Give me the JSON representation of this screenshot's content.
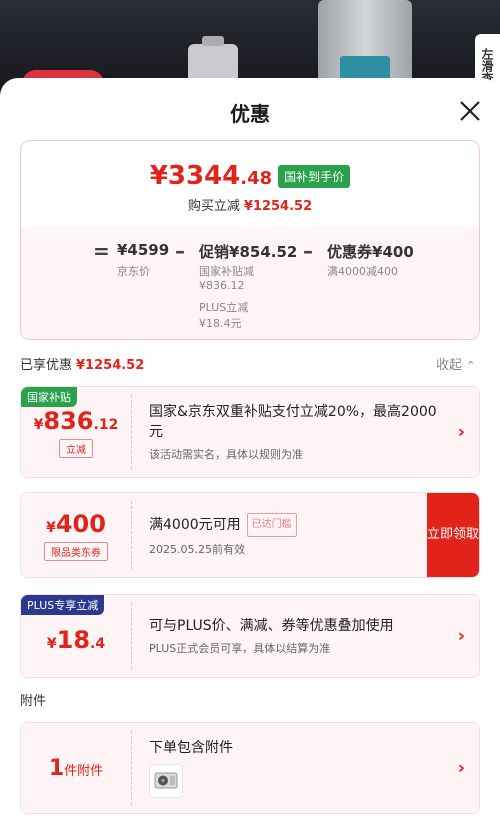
{
  "background": {
    "side_tab": "左滑查"
  },
  "sheet": {
    "title": "优惠"
  },
  "summary": {
    "final_price_int": "¥3344",
    "final_price_dec": ".48",
    "badge": "国补到手价",
    "saving_label": "购买立减",
    "saving_amount": "¥1254.52",
    "breakdown": {
      "jd_price": "¥4599",
      "jd_price_label": "京东价",
      "promo_label": "促销",
      "promo_amount": "¥854.52",
      "promo_sub1": "国家补贴减",
      "promo_sub1_amount": "¥836.12",
      "promo_sub2": "PLUS立减",
      "promo_sub2_amount": "¥18.4元",
      "coupon_label": "优惠券",
      "coupon_amount": "¥400",
      "coupon_sub": "满4000减400"
    }
  },
  "enjoyed": {
    "label": "已享优惠",
    "amount": "¥1254.52",
    "collapse": "收起"
  },
  "coupons": [
    {
      "corner": "国家补贴",
      "yen": "¥",
      "int": "836",
      "dec": ".12",
      "tag": "立减",
      "title": "国家&京东双重补贴支付立减20%，最高2000元",
      "desc": "该活动需实名，具体以规则为准"
    },
    {
      "yen": "¥",
      "int": "400",
      "tag": "限品类东券",
      "title": "满4000元可用",
      "title_tag": "已达门槛",
      "desc": "2025.05.25前有效",
      "button": "立即领取"
    },
    {
      "corner": "PLUS专享立减",
      "yen": "¥",
      "int": "18",
      "dec": ".4",
      "title": "可与PLUS价、满减、券等优惠叠加使用",
      "desc": "PLUS正式会员可享，具体以结算为准"
    }
  ],
  "attachment": {
    "section": "附件",
    "count": "1",
    "count_label": "件附件",
    "title": "下单包含附件"
  },
  "colors": {
    "accent": "#e2231a",
    "green_badge": "#2aa14b",
    "plus_badge": "#2b3a8f"
  },
  "symbols": {
    "equals": "=",
    "minus": "–",
    "chevron": "›",
    "chevron_up": "⌃"
  }
}
